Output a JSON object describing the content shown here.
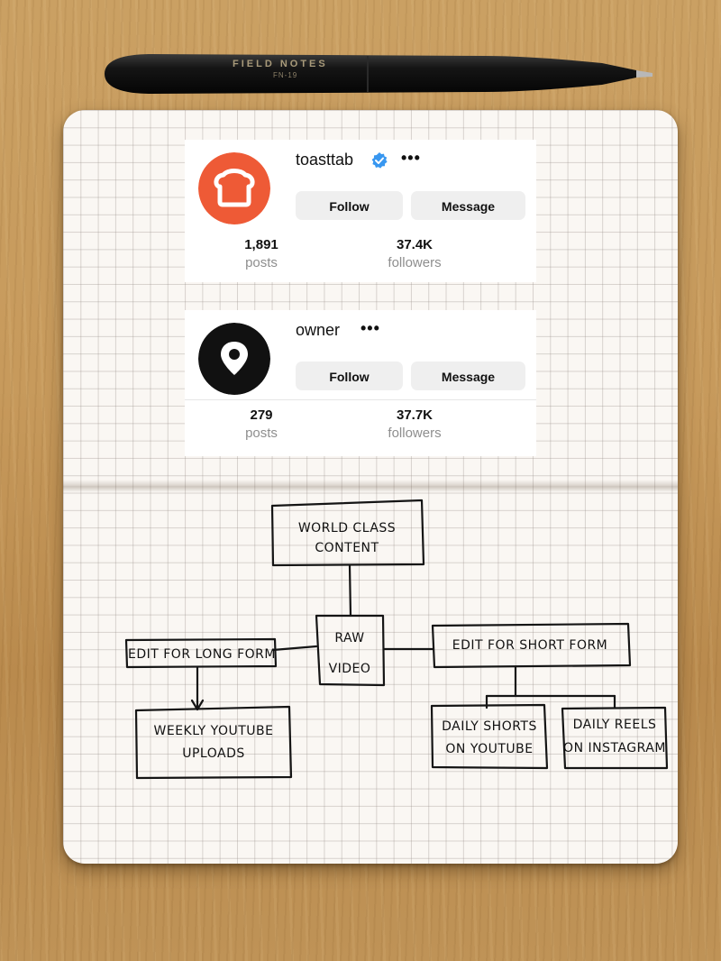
{
  "pen": {
    "brand": "FIELD NOTES",
    "model": "FN-19"
  },
  "cards": [
    {
      "username": "toasttab",
      "verified": true,
      "follow_label": "Follow",
      "message_label": "Message",
      "posts_count": "1,891",
      "posts_label": "posts",
      "followers_count": "37.4K",
      "followers_label": "followers",
      "avatar_color": "#ee5a36"
    },
    {
      "username": "owner",
      "verified": false,
      "follow_label": "Follow",
      "message_label": "Message",
      "posts_count": "279",
      "posts_label": "posts",
      "followers_count": "37.7K",
      "followers_label": "followers",
      "avatar_color": "#111111"
    }
  ],
  "diagram": {
    "world_class_line1": "WORLD CLASS",
    "world_class_line2": "CONTENT",
    "raw_line1": "RAW",
    "raw_line2": "VIDEO",
    "edit_long": "EDIT FOR LONG FORM",
    "edit_short": "EDIT FOR SHORT FORM",
    "weekly_line1": "WEEKLY YOUTUBE",
    "weekly_line2": "UPLOADS",
    "shorts_line1": "DAILY SHORTS",
    "shorts_line2": "ON YOUTUBE",
    "reels_line1": "DAILY REELS",
    "reels_line2": "ON INSTAGRAM"
  },
  "colors": {
    "verified_badge": "#3897f0",
    "button_bg": "#efefef",
    "muted_text": "#8e8e8e"
  }
}
